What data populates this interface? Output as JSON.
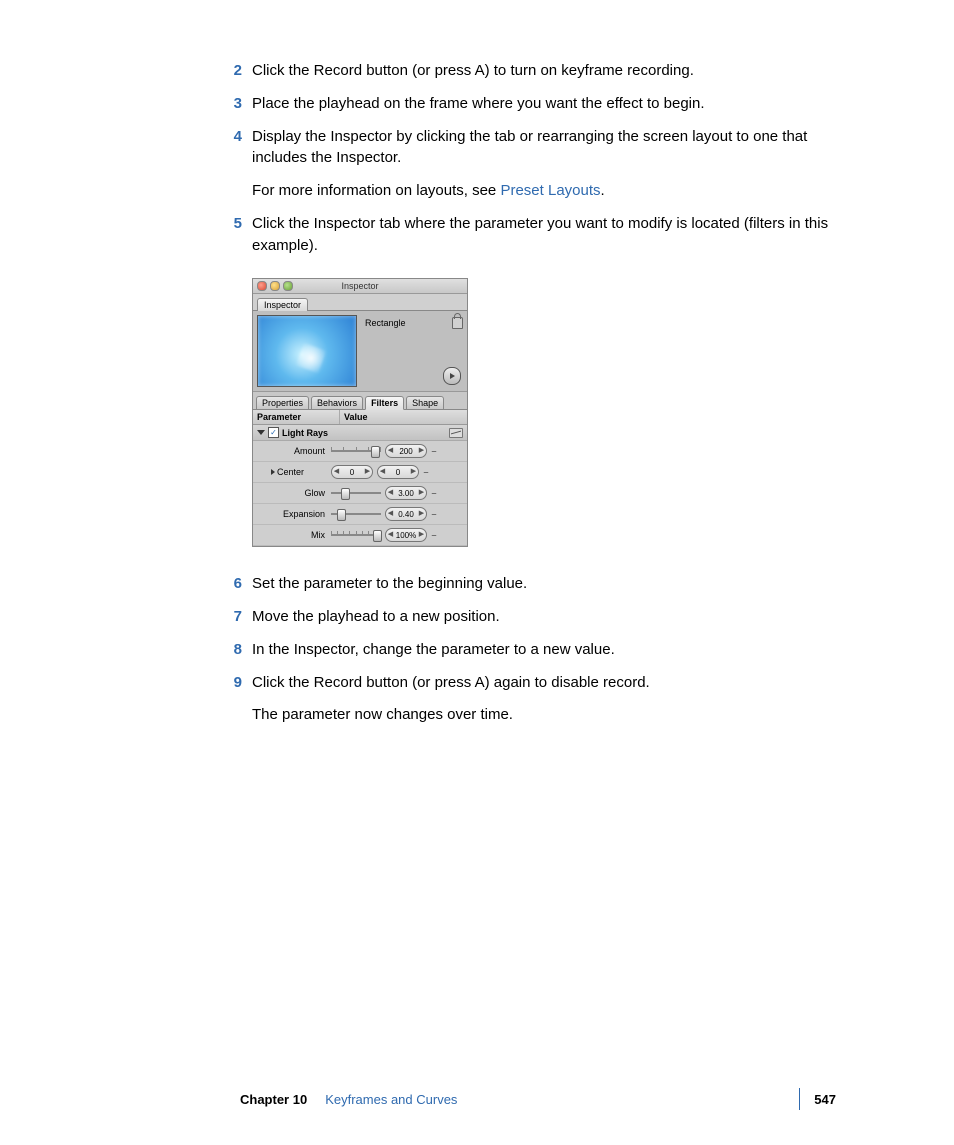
{
  "steps": {
    "s2": "Click the Record button (or press A) to turn on keyframe recording.",
    "s3": "Place the playhead on the frame where you want the effect to begin.",
    "s4": "Display the Inspector by clicking the tab or rearranging the screen layout to one that includes the Inspector.",
    "s4_extra_a": "For more information on layouts, see ",
    "s4_link": "Preset Layouts",
    "s4_extra_b": ".",
    "s5": "Click the Inspector tab where the parameter you want to modify is located (filters in this example).",
    "s6": "Set the parameter to the beginning value.",
    "s7": "Move the playhead to a new position.",
    "s8": "In the Inspector, change the parameter to a new value.",
    "s9": "Click the Record button (or press A) again to disable record.",
    "s9_extra": "The parameter now changes over time."
  },
  "step_numbers": {
    "n2": "2",
    "n3": "3",
    "n4": "4",
    "n5": "5",
    "n6": "6",
    "n7": "7",
    "n8": "8",
    "n9": "9"
  },
  "inspector": {
    "window_title": "Inspector",
    "tab": "Inspector",
    "object_name": "Rectangle",
    "subtabs": {
      "a": "Properties",
      "b": "Behaviors",
      "c": "Filters",
      "d": "Shape"
    },
    "columns": {
      "a": "Parameter",
      "b": "Value"
    },
    "group": "Light Rays",
    "params": {
      "amount": {
        "label": "Amount",
        "value": "200"
      },
      "center": {
        "label": "Center",
        "x": "0",
        "y": "0"
      },
      "glow": {
        "label": "Glow",
        "value": "3.00"
      },
      "expansion": {
        "label": "Expansion",
        "value": "0.40"
      },
      "mix": {
        "label": "Mix",
        "value": "100%"
      }
    }
  },
  "footer": {
    "chapter_label": "Chapter 10",
    "chapter_title": "Keyframes and Curves",
    "page": "547"
  }
}
